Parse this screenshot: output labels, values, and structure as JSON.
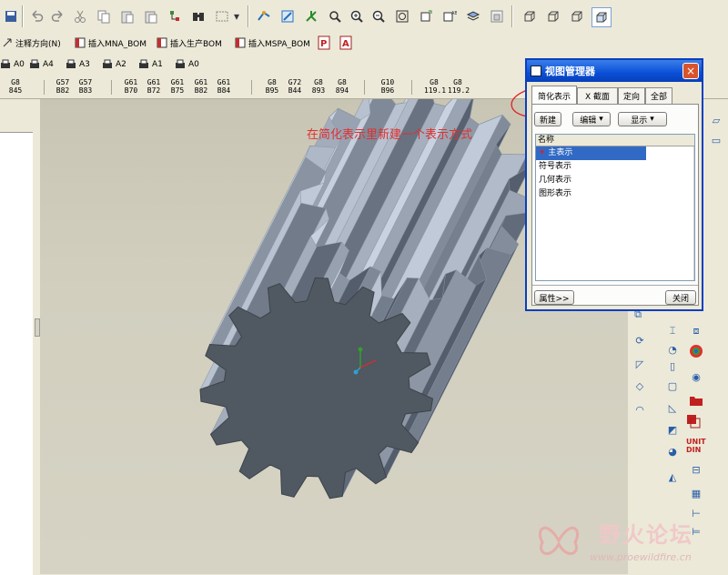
{
  "toolbar_row2": [
    {
      "label": "注释方向(N)",
      "icon": "arrow-icon"
    },
    {
      "label": "插入MNA_BOM",
      "icon": "table-icon"
    },
    {
      "label": "插入生产BOM",
      "icon": "table-icon"
    },
    {
      "label": "插入MSPA_BOM",
      "icon": "table-icon"
    }
  ],
  "paper_sizes": [
    "A0",
    "A4",
    "A3",
    "A2",
    "A1",
    "A0"
  ],
  "tolerances": [
    {
      "top": "G8",
      "bottom": "845"
    },
    {
      "top": "G57",
      "bottom": "B82"
    },
    {
      "top": "G57",
      "bottom": "B83"
    },
    {
      "top": "G61",
      "bottom": "B70"
    },
    {
      "top": "G61",
      "bottom": "B72"
    },
    {
      "top": "G61",
      "bottom": "B75"
    },
    {
      "top": "G61",
      "bottom": "B82"
    },
    {
      "top": "G61",
      "bottom": "B84"
    },
    {
      "top": "G8",
      "bottom": "B95"
    },
    {
      "top": "G72",
      "bottom": "B44"
    },
    {
      "top": "G8",
      "bottom": "893"
    },
    {
      "top": "G8",
      "bottom": "894"
    },
    {
      "top": "G10",
      "bottom": "B96"
    },
    {
      "top": "G8",
      "bottom": "119.1"
    },
    {
      "top": "G8",
      "bottom": "119.2"
    }
  ],
  "annotation": "在简化表示里新建一个表示方式",
  "dialog": {
    "title": "视图管理器",
    "close_label": "×",
    "tabs": [
      "简化表示",
      "X 截面",
      "定向",
      "全部"
    ],
    "new_button": "新建",
    "edit_button": "编辑",
    "display_button": "显示",
    "list_header": "名称",
    "items": [
      "主表示",
      "符号表示",
      "几何表示",
      "图形表示"
    ],
    "selected_index": 0,
    "properties_button": "属性>>",
    "close_button": "关闭"
  },
  "watermark": {
    "title": "野火论坛",
    "url": "www.proewildfire.cn"
  },
  "colors": {
    "annotation": "#e03030",
    "selection": "#316ac5",
    "gear_face": "#505861",
    "gear_side": "#aab4c0"
  }
}
